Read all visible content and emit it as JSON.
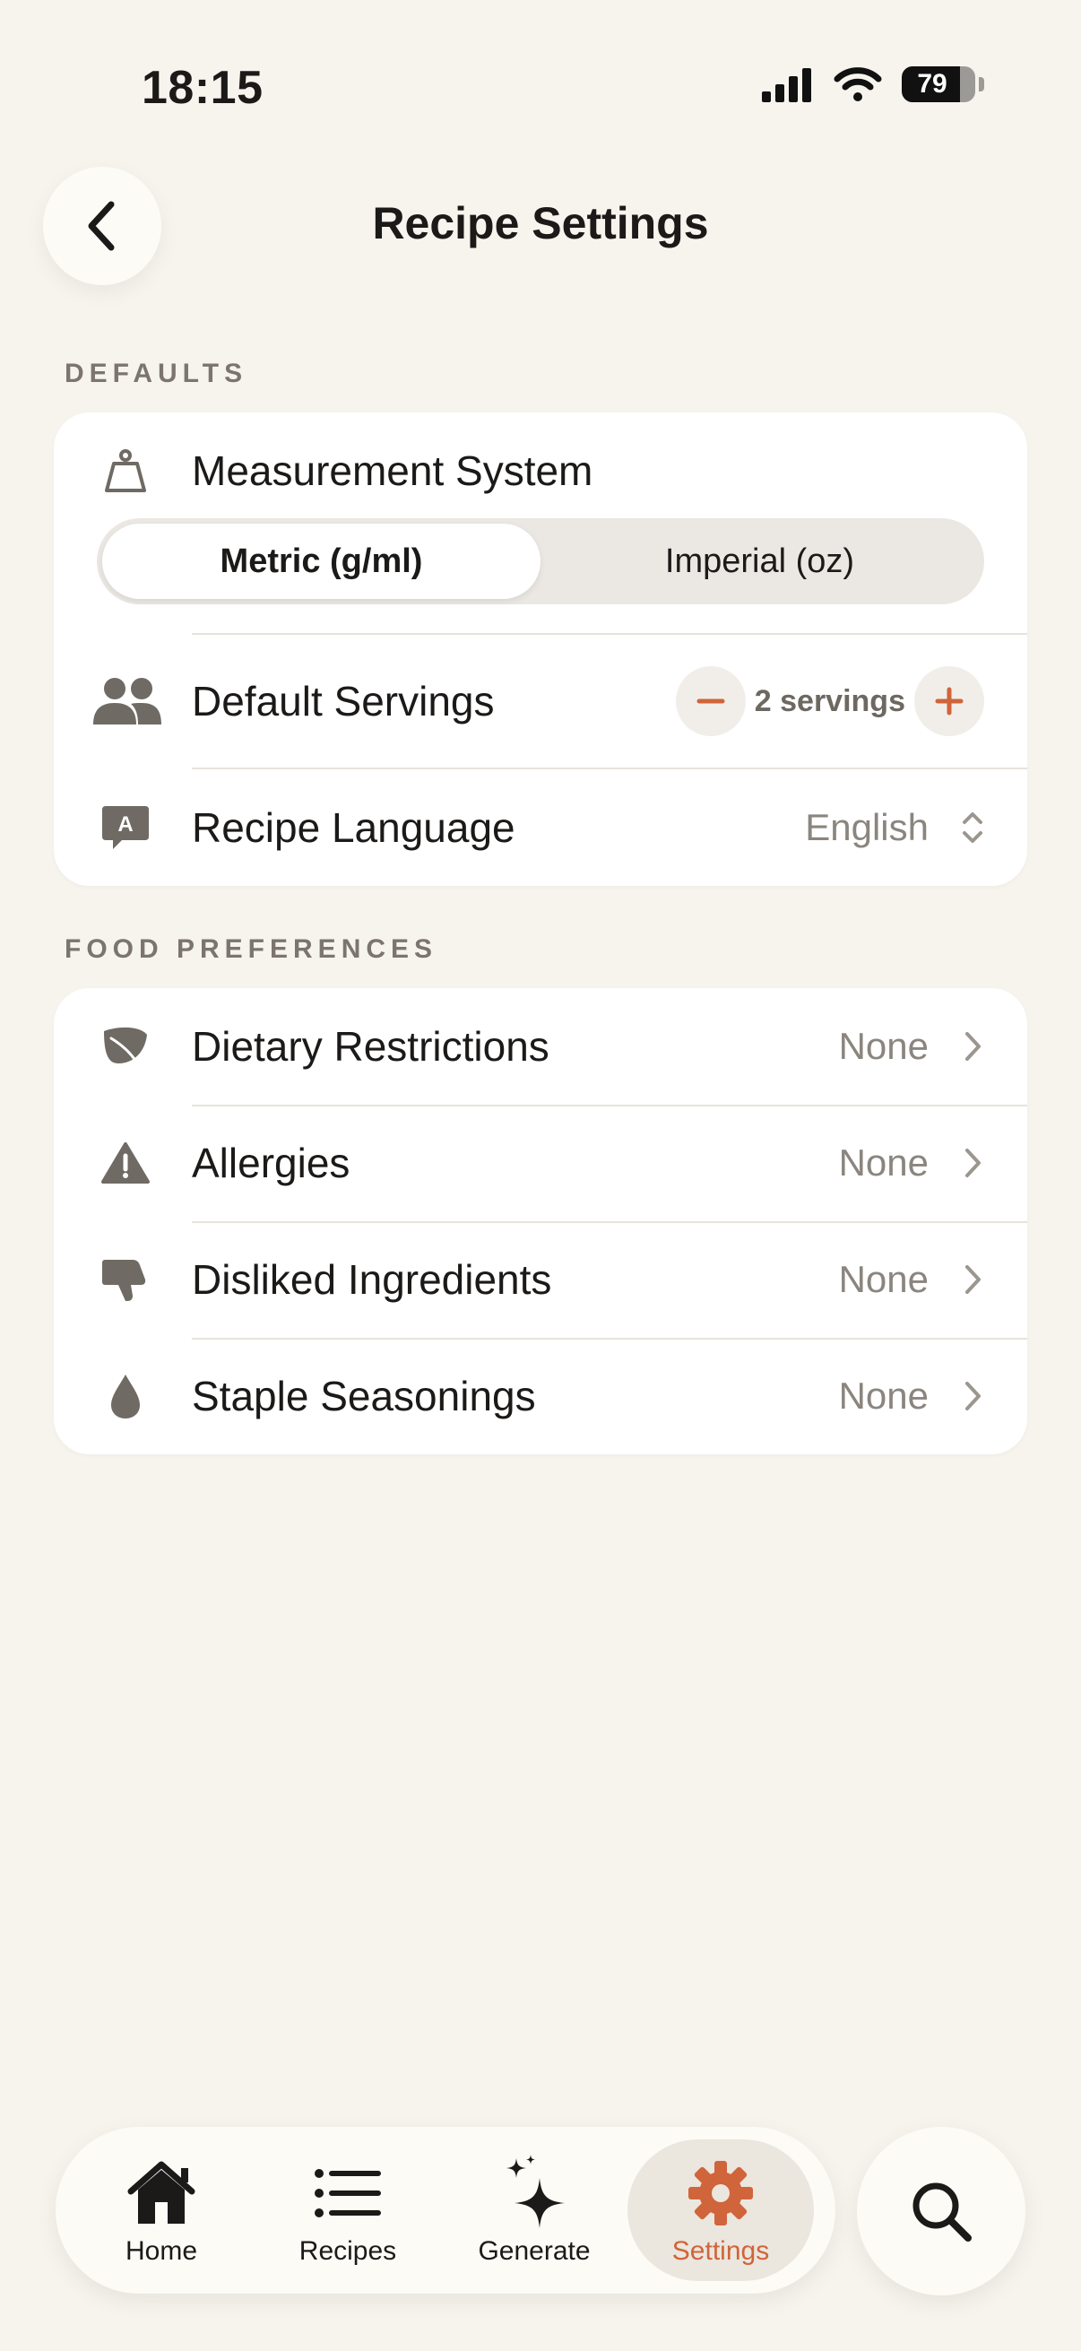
{
  "status_bar": {
    "time": "18:15",
    "battery_level": "79",
    "battery_fraction": 0.79
  },
  "header": {
    "title": "Recipe Settings",
    "back_icon": "chevron-left-icon"
  },
  "sections": {
    "defaults": {
      "label": "DEFAULTS",
      "measurement": {
        "label": "Measurement System",
        "icon": "scale-icon",
        "options": [
          "Metric (g/ml)",
          "Imperial (oz)"
        ],
        "selected": "Metric (g/ml)"
      },
      "servings": {
        "label": "Default Servings",
        "icon": "people-icon",
        "value": "2 servings"
      },
      "language": {
        "label": "Recipe Language",
        "icon": "language-icon",
        "value": "English"
      }
    },
    "food_preferences": {
      "label": "FOOD PREFERENCES",
      "items": [
        {
          "label": "Dietary Restrictions",
          "value": "None",
          "icon": "leaf-icon"
        },
        {
          "label": "Allergies",
          "value": "None",
          "icon": "warning-icon"
        },
        {
          "label": "Disliked Ingredients",
          "value": "None",
          "icon": "thumbs-down-icon"
        },
        {
          "label": "Staple Seasonings",
          "value": "None",
          "icon": "drop-icon"
        }
      ]
    }
  },
  "tab_bar": {
    "tabs": [
      {
        "label": "Home",
        "icon": "home-icon"
      },
      {
        "label": "Recipes",
        "icon": "list-icon"
      },
      {
        "label": "Generate",
        "icon": "sparkles-icon"
      },
      {
        "label": "Settings",
        "icon": "gear-icon"
      }
    ],
    "active": "Settings",
    "search_icon": "search-icon"
  },
  "colors": {
    "background": "#f7f4ee",
    "accent": "#d0643a",
    "icon_gray": "#6f6a63",
    "card": "#ffffff"
  }
}
